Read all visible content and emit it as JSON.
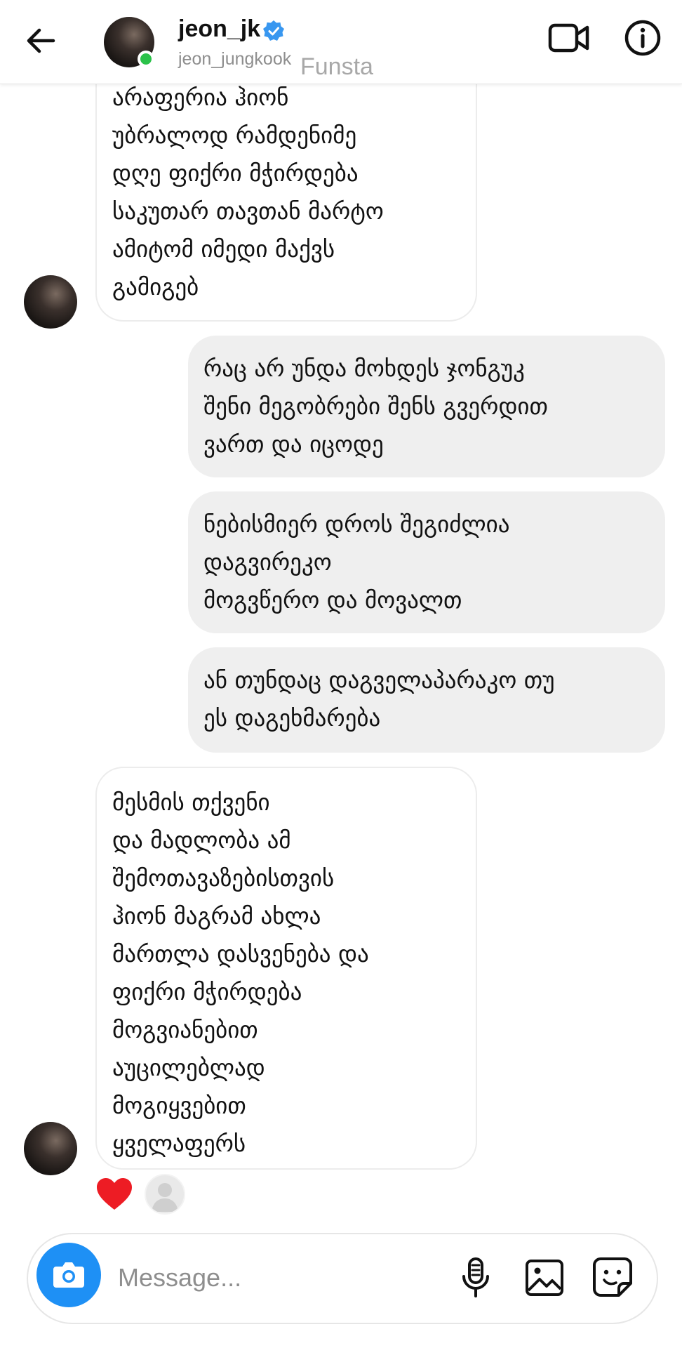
{
  "header": {
    "name": "jeon_jk",
    "handle": "jeon_jungkook",
    "watermark": "Funsta",
    "icons": {
      "back": "back-arrow-icon",
      "verified": "verified-badge-icon",
      "video": "video-call-icon",
      "info": "info-icon"
    }
  },
  "messages": [
    {
      "direction": "received",
      "lines": [
        "არაფერია ჰიონ",
        "უბრალოდ რამდენიმე",
        "დღე ფიქრი მჭირდება",
        "საკუთარ თავთან მარტო",
        "ამიტომ იმედი მაქვს",
        "გამიგებ"
      ]
    },
    {
      "direction": "sent",
      "lines": [
        "რაც არ უნდა მოხდეს ჯონგუკ",
        "შენი მეგობრები შენს გვერდით",
        "ვართ და იცოდე"
      ]
    },
    {
      "direction": "sent",
      "lines": [
        "ნებისმიერ დროს შეგიძლია",
        "დაგვირეკო",
        "მოგვწერო და მოვალთ"
      ]
    },
    {
      "direction": "sent",
      "lines": [
        "ან თუნდაც დაგველაპარაკო თუ",
        "ეს დაგეხმარება"
      ]
    },
    {
      "direction": "received",
      "lines": [
        "მესმის თქვენი",
        "და მადლობა ამ",
        "შემოთავაზებისთვის",
        "ჰიონ მაგრამ ახლა",
        "მართლა დასვენება და",
        "ფიქრი მჭირდება",
        "მოგვიანებით",
        "აუცილებლად",
        "მოგიყვებით",
        "ყველაფერს"
      ],
      "reaction": "heart-icon"
    }
  ],
  "composer": {
    "placeholder": "Message...",
    "icons": {
      "camera": "camera-icon",
      "mic": "microphone-icon",
      "gallery": "gallery-icon",
      "sticker": "sticker-icon"
    },
    "accent_color": "#1e90f5"
  },
  "colors": {
    "online": "#2bc24a",
    "verified": "#3897f0",
    "heart": "#ed1c24",
    "sent_bubble": "#efefef"
  }
}
